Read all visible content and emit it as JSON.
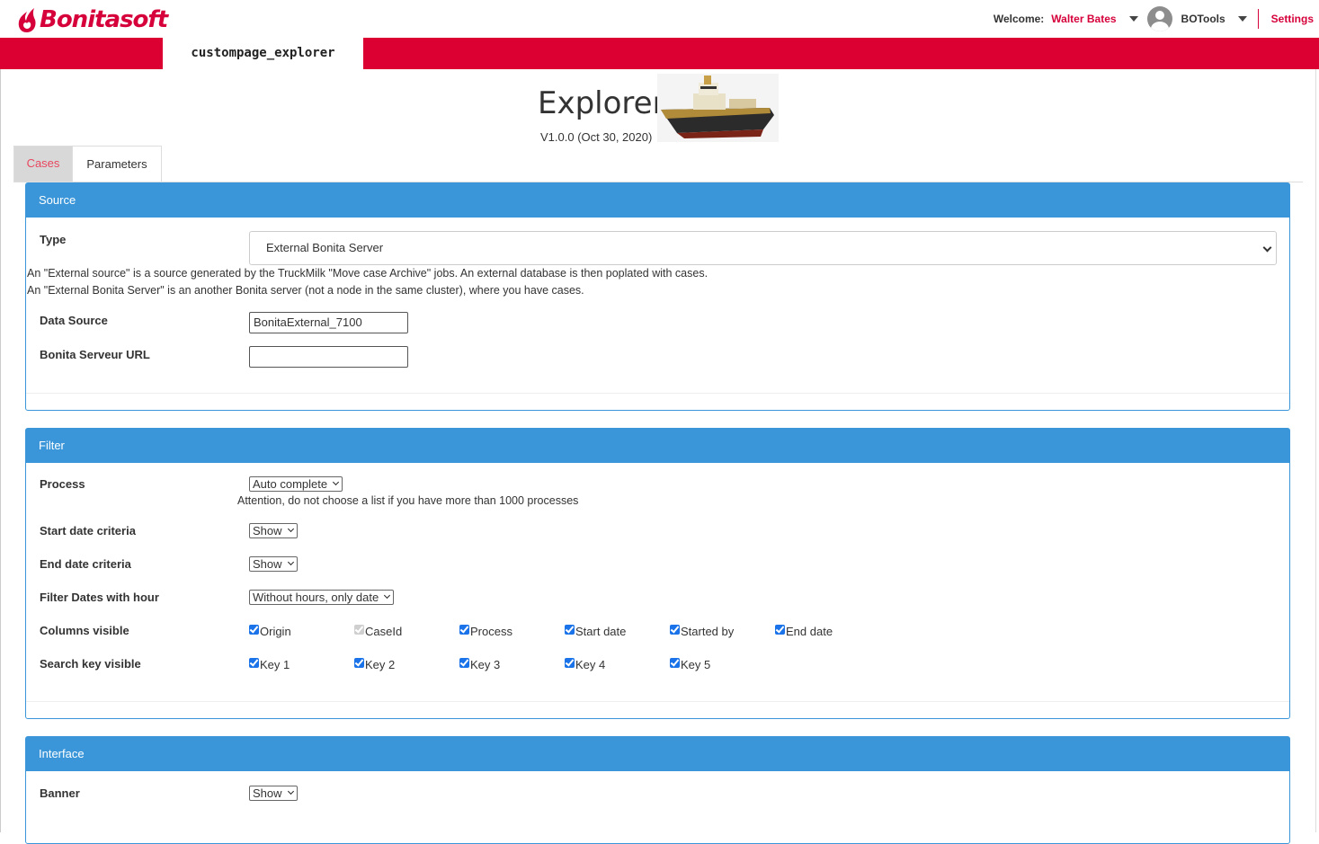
{
  "brand": {
    "name": "Bonitasoft",
    "color": "#d6003a"
  },
  "header": {
    "welcome_label": "Welcome:",
    "user_name": "Walter Bates",
    "app_name": "BOTools",
    "settings_label": "Settings"
  },
  "app_tab": {
    "label": "custompage_explorer"
  },
  "page": {
    "title": "Explorer",
    "version": "V1.0.0 (Oct 30, 2020)"
  },
  "tabs": [
    {
      "label": "Cases",
      "active": true
    },
    {
      "label": "Parameters",
      "active": false
    }
  ],
  "source": {
    "heading": "Source",
    "type_label": "Type",
    "type_value": "External Bonita Server",
    "note_1": "An \"External source\" is a source generated by the TruckMilk \"Move case Archive\" jobs. An external database is then poplated with cases.",
    "note_2": "An \"External Bonita Server\" is an another Bonita server (not a node in the same cluster), where you have cases.",
    "data_source_label": "Data Source",
    "data_source_value": "BonitaExternal_7100",
    "url_label": "Bonita Serveur URL",
    "url_value": ""
  },
  "filter": {
    "heading": "Filter",
    "process_label": "Process",
    "process_value": "Auto complete",
    "process_note": "Attention, do not choose a list if you have more than 1000 processes",
    "start_label": "Start date criteria",
    "start_value": "Show",
    "end_label": "End date criteria",
    "end_value": "Show",
    "hour_label": "Filter Dates with hour",
    "hour_value": "Without hours, only date",
    "columns_label": "Columns visible",
    "columns": [
      {
        "label": "Origin",
        "checked": true,
        "disabled": false
      },
      {
        "label": "CaseId",
        "checked": true,
        "disabled": true
      },
      {
        "label": "Process",
        "checked": true,
        "disabled": false
      },
      {
        "label": "Start date",
        "checked": true,
        "disabled": false
      },
      {
        "label": "Started by",
        "checked": true,
        "disabled": false
      },
      {
        "label": "End date",
        "checked": true,
        "disabled": false
      }
    ],
    "keys_label": "Search key visible",
    "keys": [
      {
        "label": "Key 1",
        "checked": true
      },
      {
        "label": "Key 2",
        "checked": true
      },
      {
        "label": "Key 3",
        "checked": true
      },
      {
        "label": "Key 4",
        "checked": true
      },
      {
        "label": "Key 5",
        "checked": true
      }
    ]
  },
  "interface": {
    "heading": "Interface",
    "banner_label": "Banner",
    "banner_value": "Show"
  }
}
